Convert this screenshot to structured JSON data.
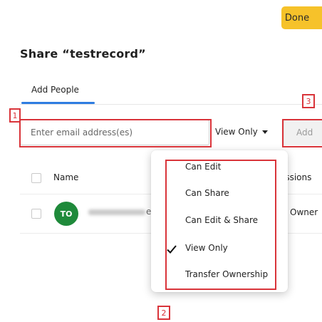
{
  "header": {
    "done_label": "Done",
    "title": "Share “testrecord”"
  },
  "tabs": [
    {
      "label": "Add People",
      "active": true
    }
  ],
  "invite": {
    "email_placeholder": "Enter email address(es)",
    "email_value": "",
    "permission_selected": "View Only",
    "add_label": "Add"
  },
  "table": {
    "headers": {
      "name": "Name",
      "permissions": "issions"
    },
    "rows": [
      {
        "avatar_initials": "TO",
        "avatar_color": "#1f8a3b",
        "name_suffix": "e",
        "permission": "Owner"
      }
    ]
  },
  "permission_menu": {
    "items": [
      {
        "label": "Can Edit",
        "checked": false
      },
      {
        "label": "Can Share",
        "checked": false
      },
      {
        "label": "Can Edit & Share",
        "checked": false
      },
      {
        "label": "View Only",
        "checked": true
      },
      {
        "label": "Transfer Ownership",
        "checked": false
      }
    ]
  },
  "annotations": {
    "marker_1": "1",
    "marker_2": "2",
    "marker_3": "3",
    "color": "#d9343a"
  },
  "colors": {
    "done_button": "#f6c22a",
    "tab_underline": "#2f7de1",
    "add_button_bg": "#f1f1f1"
  }
}
